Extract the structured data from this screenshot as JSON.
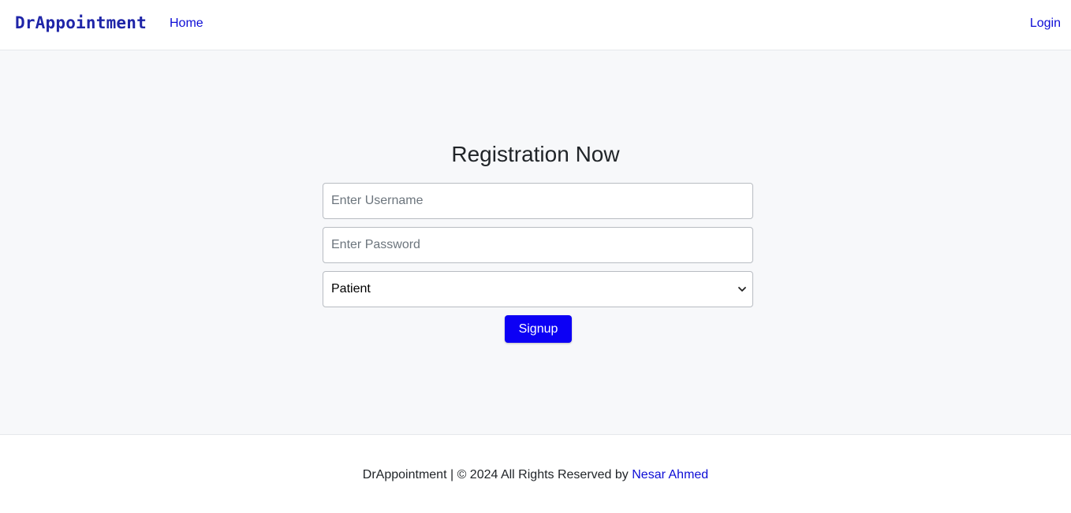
{
  "nav": {
    "brand": "DrAppointment",
    "home_label": "Home",
    "login_label": "Login"
  },
  "form": {
    "title": "Registration Now",
    "username": {
      "placeholder": "Enter Username",
      "value": ""
    },
    "password": {
      "placeholder": "Enter Password",
      "value": ""
    },
    "role": {
      "selected": "Patient",
      "icon": "chevron-down-icon"
    },
    "submit_label": "Signup"
  },
  "footer": {
    "text_prefix": "DrAppointment | © 2024 All Rights Reserved by",
    "author_link": "Nesar Ahmed"
  },
  "colors": {
    "brand": "#1f25a8",
    "link": "#0d0dd6",
    "primary_button": "#0c00f5",
    "page_background": "#f7f8fa"
  }
}
